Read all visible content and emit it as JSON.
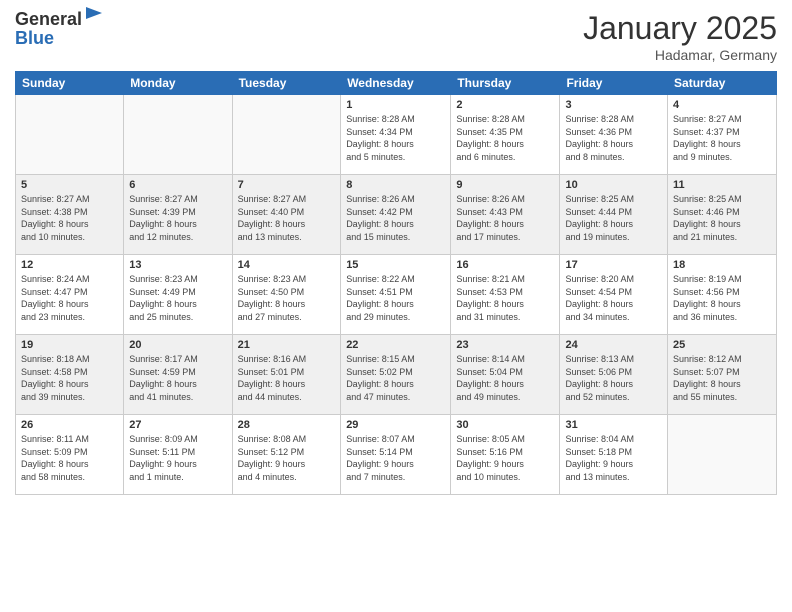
{
  "header": {
    "logo_general": "General",
    "logo_blue": "Blue",
    "month": "January 2025",
    "location": "Hadamar, Germany"
  },
  "days_of_week": [
    "Sunday",
    "Monday",
    "Tuesday",
    "Wednesday",
    "Thursday",
    "Friday",
    "Saturday"
  ],
  "weeks": [
    [
      {
        "day": "",
        "info": ""
      },
      {
        "day": "",
        "info": ""
      },
      {
        "day": "",
        "info": ""
      },
      {
        "day": "1",
        "info": "Sunrise: 8:28 AM\nSunset: 4:34 PM\nDaylight: 8 hours\nand 5 minutes."
      },
      {
        "day": "2",
        "info": "Sunrise: 8:28 AM\nSunset: 4:35 PM\nDaylight: 8 hours\nand 6 minutes."
      },
      {
        "day": "3",
        "info": "Sunrise: 8:28 AM\nSunset: 4:36 PM\nDaylight: 8 hours\nand 8 minutes."
      },
      {
        "day": "4",
        "info": "Sunrise: 8:27 AM\nSunset: 4:37 PM\nDaylight: 8 hours\nand 9 minutes."
      }
    ],
    [
      {
        "day": "5",
        "info": "Sunrise: 8:27 AM\nSunset: 4:38 PM\nDaylight: 8 hours\nand 10 minutes."
      },
      {
        "day": "6",
        "info": "Sunrise: 8:27 AM\nSunset: 4:39 PM\nDaylight: 8 hours\nand 12 minutes."
      },
      {
        "day": "7",
        "info": "Sunrise: 8:27 AM\nSunset: 4:40 PM\nDaylight: 8 hours\nand 13 minutes."
      },
      {
        "day": "8",
        "info": "Sunrise: 8:26 AM\nSunset: 4:42 PM\nDaylight: 8 hours\nand 15 minutes."
      },
      {
        "day": "9",
        "info": "Sunrise: 8:26 AM\nSunset: 4:43 PM\nDaylight: 8 hours\nand 17 minutes."
      },
      {
        "day": "10",
        "info": "Sunrise: 8:25 AM\nSunset: 4:44 PM\nDaylight: 8 hours\nand 19 minutes."
      },
      {
        "day": "11",
        "info": "Sunrise: 8:25 AM\nSunset: 4:46 PM\nDaylight: 8 hours\nand 21 minutes."
      }
    ],
    [
      {
        "day": "12",
        "info": "Sunrise: 8:24 AM\nSunset: 4:47 PM\nDaylight: 8 hours\nand 23 minutes."
      },
      {
        "day": "13",
        "info": "Sunrise: 8:23 AM\nSunset: 4:49 PM\nDaylight: 8 hours\nand 25 minutes."
      },
      {
        "day": "14",
        "info": "Sunrise: 8:23 AM\nSunset: 4:50 PM\nDaylight: 8 hours\nand 27 minutes."
      },
      {
        "day": "15",
        "info": "Sunrise: 8:22 AM\nSunset: 4:51 PM\nDaylight: 8 hours\nand 29 minutes."
      },
      {
        "day": "16",
        "info": "Sunrise: 8:21 AM\nSunset: 4:53 PM\nDaylight: 8 hours\nand 31 minutes."
      },
      {
        "day": "17",
        "info": "Sunrise: 8:20 AM\nSunset: 4:54 PM\nDaylight: 8 hours\nand 34 minutes."
      },
      {
        "day": "18",
        "info": "Sunrise: 8:19 AM\nSunset: 4:56 PM\nDaylight: 8 hours\nand 36 minutes."
      }
    ],
    [
      {
        "day": "19",
        "info": "Sunrise: 8:18 AM\nSunset: 4:58 PM\nDaylight: 8 hours\nand 39 minutes."
      },
      {
        "day": "20",
        "info": "Sunrise: 8:17 AM\nSunset: 4:59 PM\nDaylight: 8 hours\nand 41 minutes."
      },
      {
        "day": "21",
        "info": "Sunrise: 8:16 AM\nSunset: 5:01 PM\nDaylight: 8 hours\nand 44 minutes."
      },
      {
        "day": "22",
        "info": "Sunrise: 8:15 AM\nSunset: 5:02 PM\nDaylight: 8 hours\nand 47 minutes."
      },
      {
        "day": "23",
        "info": "Sunrise: 8:14 AM\nSunset: 5:04 PM\nDaylight: 8 hours\nand 49 minutes."
      },
      {
        "day": "24",
        "info": "Sunrise: 8:13 AM\nSunset: 5:06 PM\nDaylight: 8 hours\nand 52 minutes."
      },
      {
        "day": "25",
        "info": "Sunrise: 8:12 AM\nSunset: 5:07 PM\nDaylight: 8 hours\nand 55 minutes."
      }
    ],
    [
      {
        "day": "26",
        "info": "Sunrise: 8:11 AM\nSunset: 5:09 PM\nDaylight: 8 hours\nand 58 minutes."
      },
      {
        "day": "27",
        "info": "Sunrise: 8:09 AM\nSunset: 5:11 PM\nDaylight: 9 hours\nand 1 minute."
      },
      {
        "day": "28",
        "info": "Sunrise: 8:08 AM\nSunset: 5:12 PM\nDaylight: 9 hours\nand 4 minutes."
      },
      {
        "day": "29",
        "info": "Sunrise: 8:07 AM\nSunset: 5:14 PM\nDaylight: 9 hours\nand 7 minutes."
      },
      {
        "day": "30",
        "info": "Sunrise: 8:05 AM\nSunset: 5:16 PM\nDaylight: 9 hours\nand 10 minutes."
      },
      {
        "day": "31",
        "info": "Sunrise: 8:04 AM\nSunset: 5:18 PM\nDaylight: 9 hours\nand 13 minutes."
      },
      {
        "day": "",
        "info": ""
      }
    ]
  ]
}
